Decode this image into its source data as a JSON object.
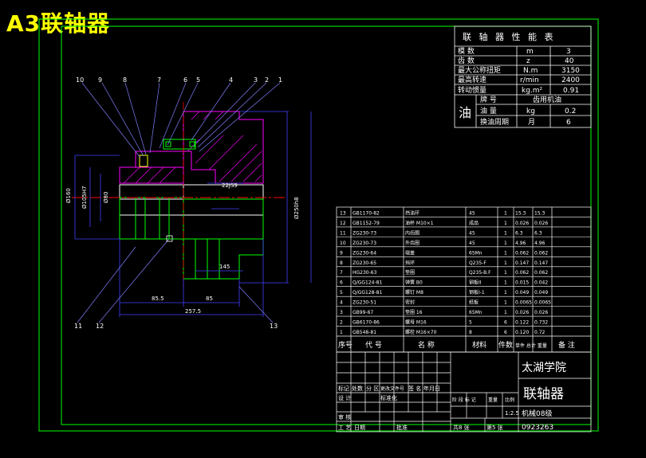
{
  "page_title": "A3联轴器",
  "perf_table": {
    "title": "联 轴 器 性 能 表",
    "rows": [
      [
        "模 数",
        "m",
        "3"
      ],
      [
        "齿 数",
        "z",
        "40"
      ],
      [
        "最大公称扭矩",
        "N.m",
        "3150"
      ],
      [
        "最高转速",
        "r/min",
        "2400"
      ],
      [
        "转动惯量",
        "kg.m²",
        "0.91"
      ]
    ],
    "oil_label": "油",
    "oil_rows": [
      [
        "牌 号",
        "",
        "齿用机油"
      ],
      [
        "油 量",
        "kg",
        "0.2"
      ],
      [
        "换油周期",
        "月",
        "6"
      ]
    ]
  },
  "balloons": [
    "10",
    "9",
    "8",
    "7",
    "6",
    "5",
    "4",
    "3",
    "2",
    "1",
    "11",
    "12",
    "13"
  ],
  "dims": {
    "d1": "Ø160",
    "d2": "Ø105H7",
    "d3": "Ø250h8",
    "d4": "Ø80",
    "l1": "145",
    "l2": "85.5",
    "l3": "85",
    "l4": "257.5",
    "key": "22JS9"
  },
  "bom": {
    "rows": [
      [
        "13",
        "GB1170-82",
        "挡油环",
        "45",
        "1",
        "15.3",
        "15.3"
      ],
      [
        "12",
        "GB1152-79",
        "油杯 M10×1",
        "成品",
        "1",
        "0.026",
        "0.026"
      ],
      [
        "11",
        "ZG230-73",
        "内齿圈",
        "45",
        "1",
        "6.3",
        "6.3"
      ],
      [
        "10",
        "ZG230-73",
        "外齿圈",
        "45",
        "1",
        "4.96",
        "4.96"
      ],
      [
        "9",
        "ZG230-64",
        "端盖",
        "65Mn",
        "1",
        "0.062",
        "0.062"
      ],
      [
        "8",
        "ZG230-65",
        "挡环",
        "Q235-F",
        "1",
        "0.147",
        "0.147"
      ],
      [
        "7",
        "HG230-63",
        "垫圈",
        "Q235-B.F",
        "1",
        "0.062",
        "0.062"
      ],
      [
        "6",
        "Q/GG124-81",
        "弹簧 B0",
        "钢板II",
        "1",
        "0.015",
        "0.042"
      ],
      [
        "5",
        "Q/GG128-81",
        "螺钉 M8",
        "钢板I-1",
        "1",
        "0.049",
        "0.049"
      ],
      [
        "4",
        "ZG230-51",
        "密封",
        "纸板",
        "1",
        "0.0065",
        "0.0065"
      ],
      [
        "3",
        "GB99-67",
        "垫圈 16",
        "65Mn",
        "1",
        "0.026",
        "0.026"
      ],
      [
        "2",
        "GB6170-86",
        "螺母 M16",
        "5",
        "6",
        "0.122",
        "0.732"
      ],
      [
        "1",
        "GB548-81",
        "螺栓 M16×70",
        "8",
        "6",
        "0.120",
        "0.72"
      ]
    ],
    "header": [
      "序号",
      "代 号",
      "名 称",
      "材料",
      "件数",
      "单件 总计 重量",
      "备 注"
    ]
  },
  "title_block": {
    "school": "太湖学院",
    "drawing_name": "联轴器",
    "scale": "1:2.5",
    "class": "机械08级",
    "sheets_total": "共8 张",
    "sheet_no": "第5 张",
    "drawing_no": "0923263",
    "labels": [
      "标记",
      "处数",
      "分 区",
      "更改文件号",
      "签 名",
      "年月日",
      "设 计",
      "标准化",
      "阶 段 标 记",
      "重量",
      "比例",
      "审 核",
      "工 艺",
      "日期",
      "批准"
    ]
  },
  "colors": {
    "background": "#000000",
    "frame": "#00ff00",
    "title": "#ffff00",
    "outline": "#ff00ff",
    "dimension": "#0000ff",
    "center": "#ff0000",
    "text": "#ffffff",
    "leader": "#8080ff"
  }
}
